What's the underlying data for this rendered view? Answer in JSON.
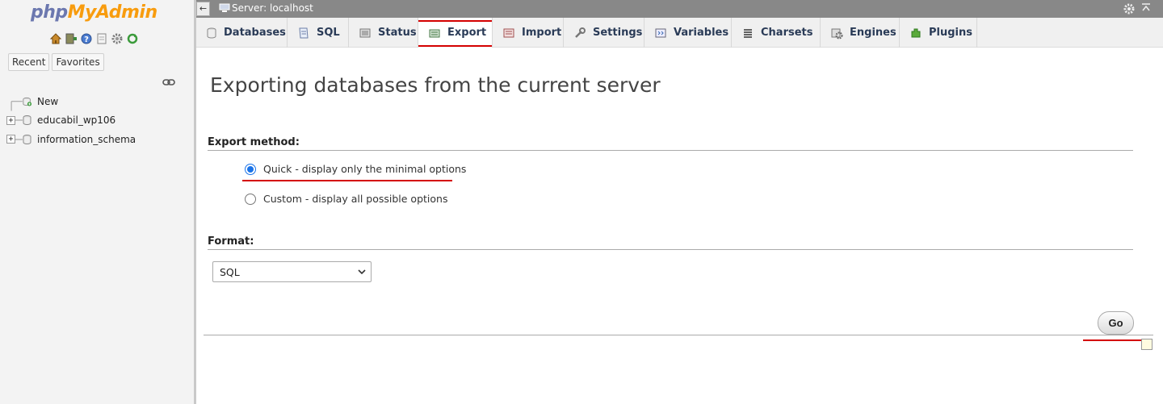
{
  "nav": {
    "logo_php": "php",
    "logo_myadmin": "MyAdmin",
    "tab_recent": "Recent",
    "tab_favorites": "Favorites",
    "tree": [
      {
        "label": "New",
        "icon": "new-db-icon"
      },
      {
        "label": "educabil_wp106",
        "icon": "database-icon"
      },
      {
        "label": "information_schema",
        "icon": "database-icon"
      }
    ]
  },
  "serverbar": {
    "collapse": "←",
    "label": "Server: localhost"
  },
  "menu": {
    "tabs": [
      {
        "label": "Databases",
        "icon": "databases-icon"
      },
      {
        "label": "SQL",
        "icon": "sql-icon"
      },
      {
        "label": "Status",
        "icon": "status-icon"
      },
      {
        "label": "Export",
        "icon": "export-icon",
        "active": true
      },
      {
        "label": "Import",
        "icon": "import-icon"
      },
      {
        "label": "Settings",
        "icon": "settings-icon"
      },
      {
        "label": "Variables",
        "icon": "variables-icon"
      },
      {
        "label": "Charsets",
        "icon": "charsets-icon"
      },
      {
        "label": "Engines",
        "icon": "engines-icon"
      },
      {
        "label": "Plugins",
        "icon": "plugins-icon"
      }
    ]
  },
  "main": {
    "title": "Exporting databases from the current server",
    "export_method_label": "Export method:",
    "quick_option": "Quick - display only the minimal options",
    "custom_option": "Custom - display all possible options",
    "selected_method": "quick",
    "format_label": "Format:",
    "format_value": "SQL",
    "go_label": "Go"
  },
  "colors": {
    "accent_red": "#d40000",
    "radio_blue": "#1a73e8",
    "logo_php": "#6c78af",
    "logo_myadmin": "#f89c0e"
  }
}
